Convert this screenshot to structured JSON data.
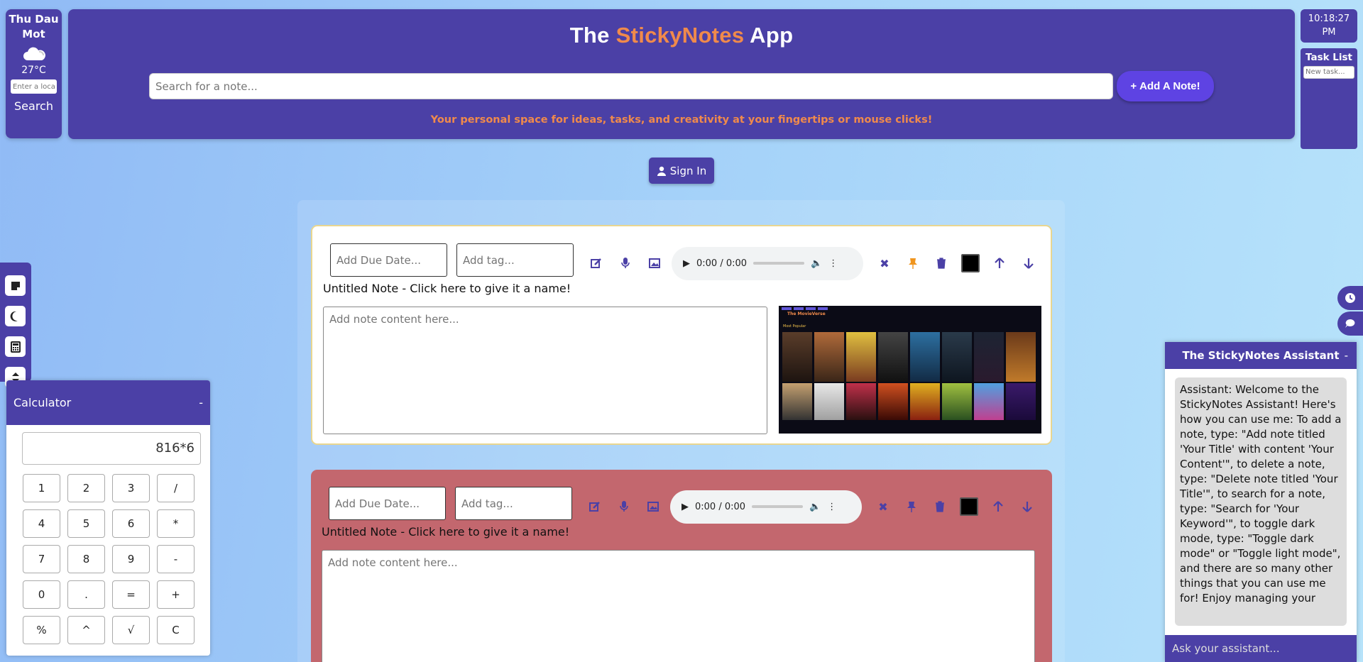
{
  "weather": {
    "city": "Thu Dau Mot",
    "temp": "27°C",
    "placeholder": "Enter a location",
    "search_label": "Search"
  },
  "header": {
    "title_pre": "The ",
    "title_accent": "StickyNotes",
    "title_post": " App",
    "search_placeholder": "Search for a note...",
    "add_label": "Add A Note!",
    "tagline": "Your personal space for ideas, tasks, and creativity at your fingertips or mouse clicks!"
  },
  "clock": {
    "time": "10:18:27",
    "ampm": "PM"
  },
  "tasklist": {
    "title": "Task List",
    "placeholder": "New task..."
  },
  "signin": {
    "label": "Sign In"
  },
  "sidebar": {
    "items": [
      "note-icon",
      "moon-icon",
      "calculator-icon",
      "arrows-icon"
    ]
  },
  "notes": [
    {
      "due_placeholder": "Add Due Date...",
      "tag_placeholder": "Add tag...",
      "audio_time": "0:00 / 0:00",
      "title": "Untitled Note - Click here to give it a name!",
      "content_placeholder": "Add note content here...",
      "color": "#ffffff",
      "thumb_brand": "The MovieVerse",
      "thumb_heading": "Most Popular"
    },
    {
      "due_placeholder": "Add Due Date...",
      "tag_placeholder": "Add tag...",
      "audio_time": "0:00 / 0:00",
      "title": "Untitled Note - Click here to give it a name!",
      "content_placeholder": "Add note content here...",
      "color": "#c3676e"
    }
  ],
  "assistant": {
    "title": "The StickyNotes Assistant",
    "minimize": "-",
    "message": "Assistant: Welcome to the StickyNotes Assistant! Here's how you can use me: To add a note, type: \"Add note titled 'Your Title' with content 'Your Content'\", to delete a note, type: \"Delete note titled 'Your Title'\", to search for a note, type: \"Search for 'Your Keyword'\", to toggle dark mode, type: \"Toggle dark mode\" or \"Toggle light mode\", and there are so many other things that you can use me for! Enjoy managing your",
    "input_placeholder": "Ask your assistant..."
  },
  "calculator": {
    "title": "Calculator",
    "minimize": "-",
    "display": "816*6",
    "keys": [
      "1",
      "2",
      "3",
      "/",
      "4",
      "5",
      "6",
      "*",
      "7",
      "8",
      "9",
      "-",
      "0",
      ".",
      "=",
      "+",
      "%",
      "^",
      "√",
      "C"
    ]
  },
  "colors": {
    "brand": "#4b40a6",
    "accent": "#f08a4b",
    "button": "#5e43e3"
  }
}
